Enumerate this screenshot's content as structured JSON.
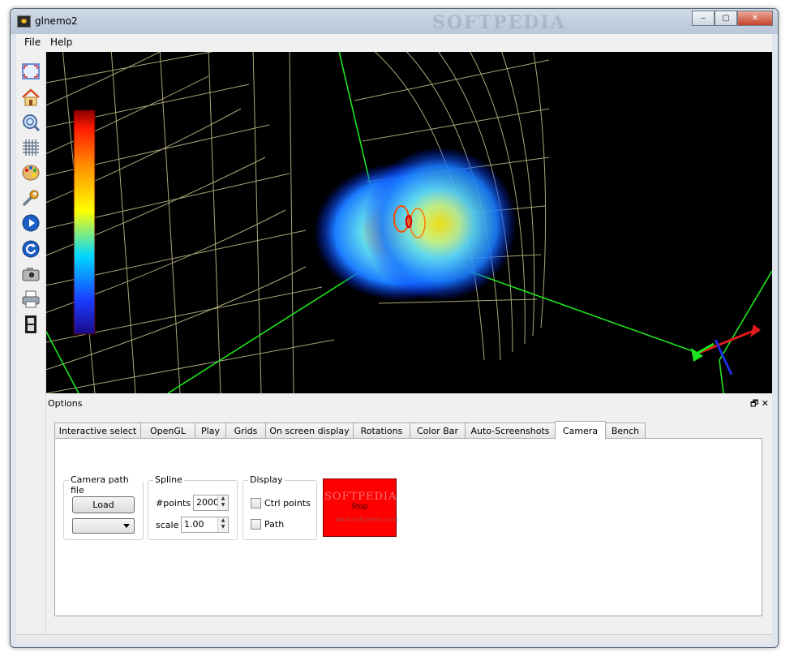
{
  "window": {
    "title": "glnemo2",
    "watermark": "SOFTPEDIA"
  },
  "title_buttons": {
    "minimize": "‒",
    "maximize": "▢",
    "close": "✕"
  },
  "menu": [
    "File",
    "Help"
  ],
  "toolbar": [
    "fullscreen-icon",
    "home-icon",
    "zoom-icon",
    "grid-icon",
    "palette-icon",
    "wrench-icon",
    "play-icon",
    "reload-icon",
    "camera-icon",
    "printer-icon",
    "film-icon"
  ],
  "dock": {
    "title": "Options",
    "float_glyph": "🗗",
    "close_glyph": "✕"
  },
  "tabs": [
    "Interactive select",
    "OpenGL",
    "Play",
    "Grids",
    "On screen display",
    "Rotations",
    "Color Bar",
    "Auto-Screenshots",
    "Camera",
    "Bench"
  ],
  "active_tab": "Camera",
  "camera_panel": {
    "camera_path_file": {
      "title": "Camera path file",
      "load_label": "Load",
      "combo_value": ""
    },
    "spline": {
      "title": "Spline",
      "points_label": "#points",
      "points_value": "2000",
      "scale_label": "scale",
      "scale_value": "1.00"
    },
    "display": {
      "title": "Display",
      "ctrl_points_label": "Ctrl points",
      "path_label": "Path"
    },
    "color_button": {
      "label": "Stop",
      "color": "#fe0000"
    },
    "overlay_watermark": "SOFTPEDIA",
    "overlay_sub": "www.softpedia.com"
  }
}
